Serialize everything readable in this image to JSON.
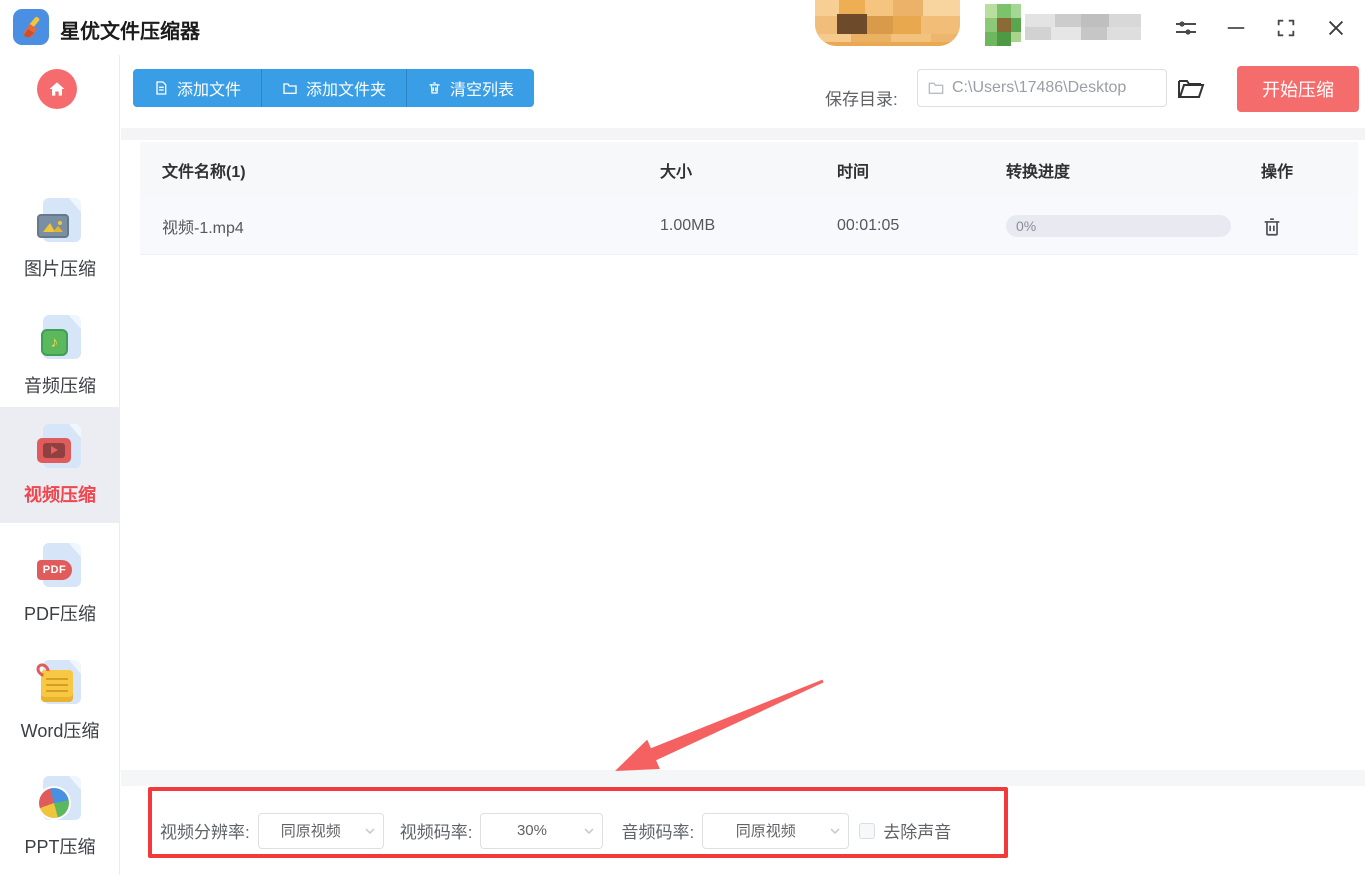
{
  "window": {
    "title": "星优文件压缩器"
  },
  "toolbar": {
    "add_file": "添加文件",
    "add_folder": "添加文件夹",
    "clear_list": "清空列表",
    "save_dir_label": "保存目录:",
    "save_dir_path": "C:\\Users\\17486\\Desktop",
    "start_compress": "开始压缩"
  },
  "sidebar": {
    "items": [
      {
        "label": "图片压缩",
        "selected": false
      },
      {
        "label": "音频压缩",
        "selected": false
      },
      {
        "label": "视频压缩",
        "selected": true
      },
      {
        "label": "PDF压缩",
        "selected": false
      },
      {
        "label": "Word压缩",
        "selected": false
      },
      {
        "label": "PPT压缩",
        "selected": false
      }
    ],
    "pdf_badge": "PDF",
    "audio_badge_note": "♪"
  },
  "table": {
    "headers": {
      "name": "文件名称(1)",
      "size": "大小",
      "time": "时间",
      "progress": "转换进度",
      "action": "操作"
    },
    "rows": [
      {
        "name": "视频-1.mp4",
        "size": "1.00MB",
        "time": "00:01:05",
        "progress": "0%"
      }
    ]
  },
  "settings": {
    "resolution_label": "视频分辨率:",
    "resolution_value": "同原视频",
    "video_bitrate_label": "视频码率:",
    "video_bitrate_value": "30%",
    "audio_bitrate_label": "音频码率:",
    "audio_bitrate_value": "同原视频",
    "remove_audio_label": "去除声音",
    "remove_audio_checked": false
  },
  "colors": {
    "accent_blue": "#3a9ee6",
    "accent_red": "#f56c6c",
    "selected_tab_red": "#f0464e",
    "annotation_red": "#f23a3a",
    "progress_track": "#e8eaf1"
  }
}
